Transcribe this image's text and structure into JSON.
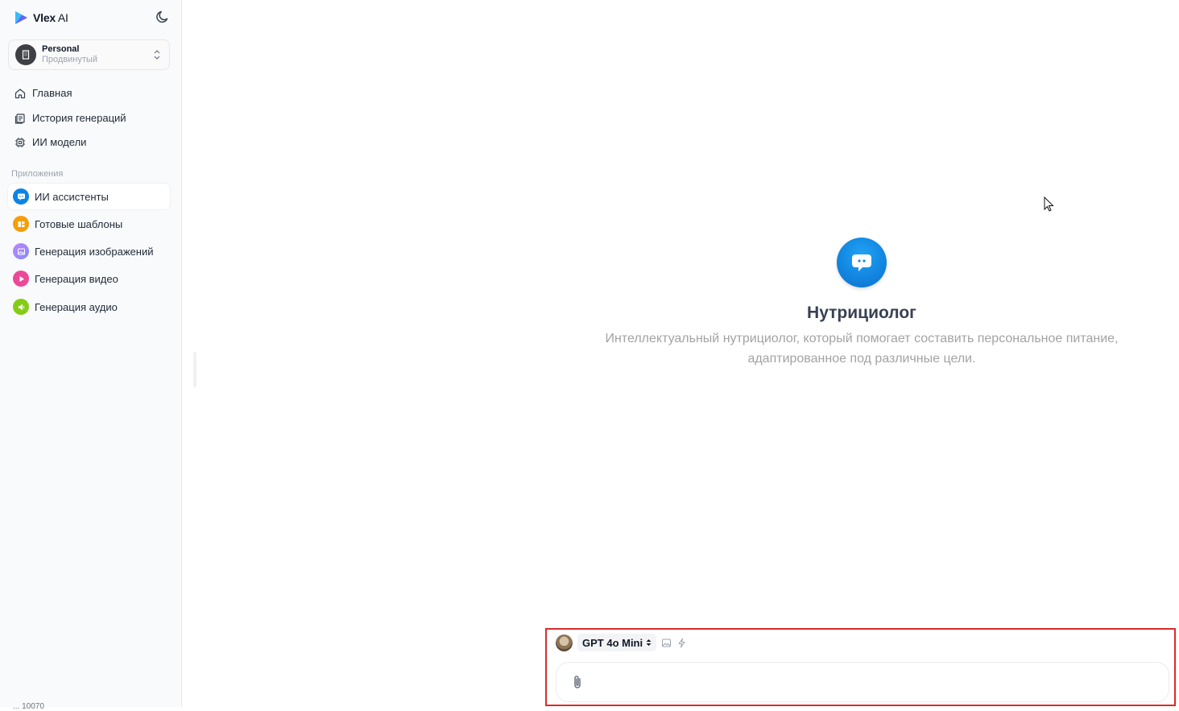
{
  "app": {
    "name": "Vlex",
    "name_suffix": " AI"
  },
  "workspace": {
    "name": "Personal",
    "plan": "Продвинутый"
  },
  "nav": [
    {
      "label": "Главная",
      "icon": "home-icon"
    },
    {
      "label": "История генераций",
      "icon": "history-icon"
    },
    {
      "label": "ИИ модели",
      "icon": "chip-icon"
    }
  ],
  "apps_section_label": "Приложения",
  "apps": [
    {
      "label": "ИИ ассистенты",
      "icon": "chat-bubble-icon",
      "color": "#0b84e6",
      "active": true
    },
    {
      "label": "Готовые шаблоны",
      "icon": "template-icon",
      "color": "#f59e0b",
      "active": false
    },
    {
      "label": "Генерация изображений",
      "icon": "image-icon",
      "color": "#a78bfa",
      "active": false
    },
    {
      "label": "Генерация видео",
      "icon": "play-icon",
      "color": "#ec4899",
      "active": false
    },
    {
      "label": "Генерация аудио",
      "icon": "audio-icon",
      "color": "#84cc16",
      "active": false
    }
  ],
  "footer_text": "... 10070",
  "assistant": {
    "title": "Нутрициолог",
    "description_line1": "Интеллектуальный нутрициолог, который помогает составить персональное питание,",
    "description_line2": "адаптированное под различные цели."
  },
  "composer": {
    "model": "GPT 4o Mini",
    "input_value": "",
    "input_placeholder": ""
  },
  "colors": {
    "accent": "#0b84e6",
    "highlight_outline": "#d92c2c"
  }
}
